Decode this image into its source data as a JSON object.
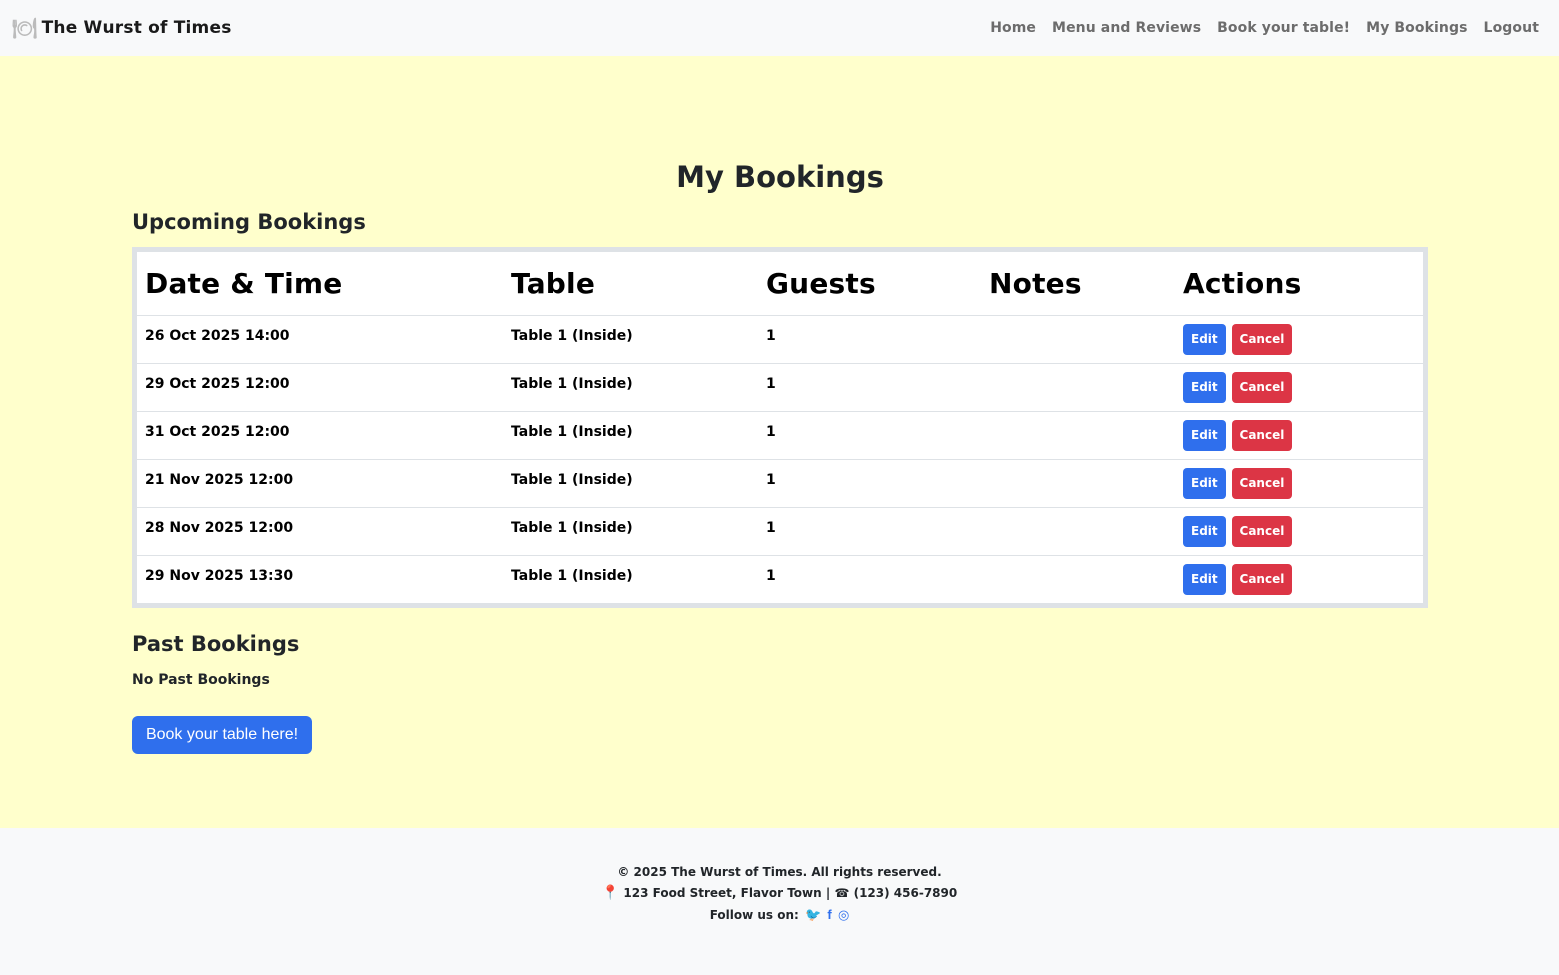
{
  "nav": {
    "brand_icon": "plate-cutlery-icon",
    "brand_icon_glyph": "🍽",
    "brand": "The Wurst of Times",
    "links": [
      "Home",
      "Menu and Reviews",
      "Book your table!",
      "My Bookings",
      "Logout"
    ]
  },
  "page": {
    "title": "My Bookings",
    "upcoming_title": "Upcoming Bookings",
    "past_title": "Past Bookings",
    "no_past": "No Past Bookings",
    "book_button": "Book your table here!"
  },
  "table": {
    "headers": [
      "Date & Time",
      "Table",
      "Guests",
      "Notes",
      "Actions"
    ],
    "rows": [
      {
        "datetime": "26 Oct 2025 14:00",
        "table": "Table 1 (Inside)",
        "guests": "1",
        "notes": ""
      },
      {
        "datetime": "29 Oct 2025 12:00",
        "table": "Table 1 (Inside)",
        "guests": "1",
        "notes": ""
      },
      {
        "datetime": "31 Oct 2025 12:00",
        "table": "Table 1 (Inside)",
        "guests": "1",
        "notes": ""
      },
      {
        "datetime": "21 Nov 2025 12:00",
        "table": "Table 1 (Inside)",
        "guests": "1",
        "notes": ""
      },
      {
        "datetime": "28 Nov 2025 12:00",
        "table": "Table 1 (Inside)",
        "guests": "1",
        "notes": ""
      },
      {
        "datetime": "29 Nov 2025 13:30",
        "table": "Table 1 (Inside)",
        "guests": "1",
        "notes": ""
      }
    ],
    "edit_label": "Edit",
    "cancel_label": "Cancel"
  },
  "footer": {
    "copyright": "© 2025 The Wurst of Times. All rights reserved.",
    "address": "123 Food Street, Flavor Town",
    "separator": "|",
    "phone": "(123) 456-7890",
    "follow": "Follow us on:",
    "pin_glyph": "📍",
    "phone_glyph": "☎",
    "twitter_glyph": "🐦",
    "facebook_glyph": "f",
    "instagram_glyph": "◎"
  },
  "colors": {
    "page_bg": "#ffffcc",
    "nav_bg": "#f8f9fa",
    "primary": "#2f6fed",
    "danger": "#dc3545"
  }
}
